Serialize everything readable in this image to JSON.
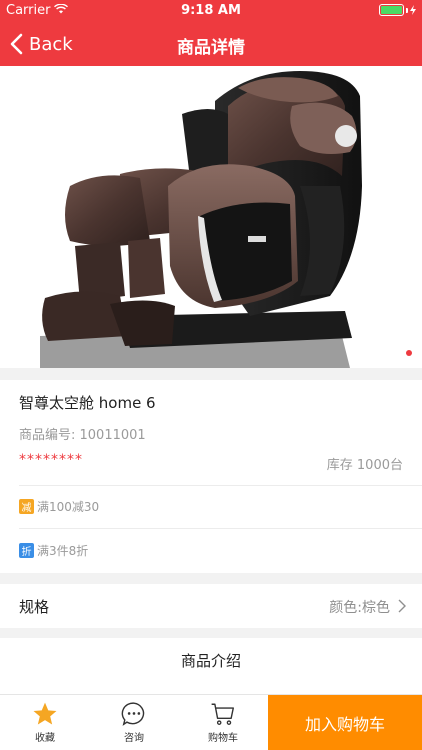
{
  "status_bar": {
    "carrier": "Carrier",
    "time": "9:18 AM"
  },
  "nav": {
    "back_label": "Back",
    "title": "商品详情"
  },
  "product": {
    "name": "智尊太空舱 home 6",
    "code": "商品编号: 10011001",
    "price_masked": "********",
    "stock": "库存 1000台",
    "promotions": [
      {
        "badge": "减",
        "text": "满100减30",
        "badge_color": "#f5a623"
      },
      {
        "badge": "折",
        "text": "满3件8折",
        "badge_color": "#3a8ee6"
      }
    ]
  },
  "spec": {
    "label": "规格",
    "value": "颜色:棕色"
  },
  "intro": {
    "title": "商品介绍"
  },
  "bottom_bar": {
    "favorite": "收藏",
    "consult": "咨询",
    "cart": "购物车",
    "add_to_cart": "加入购物车"
  },
  "colors": {
    "brand_red": "#ee3a3f",
    "cta_orange": "#ff8c00",
    "star_orange": "#f5a623"
  }
}
